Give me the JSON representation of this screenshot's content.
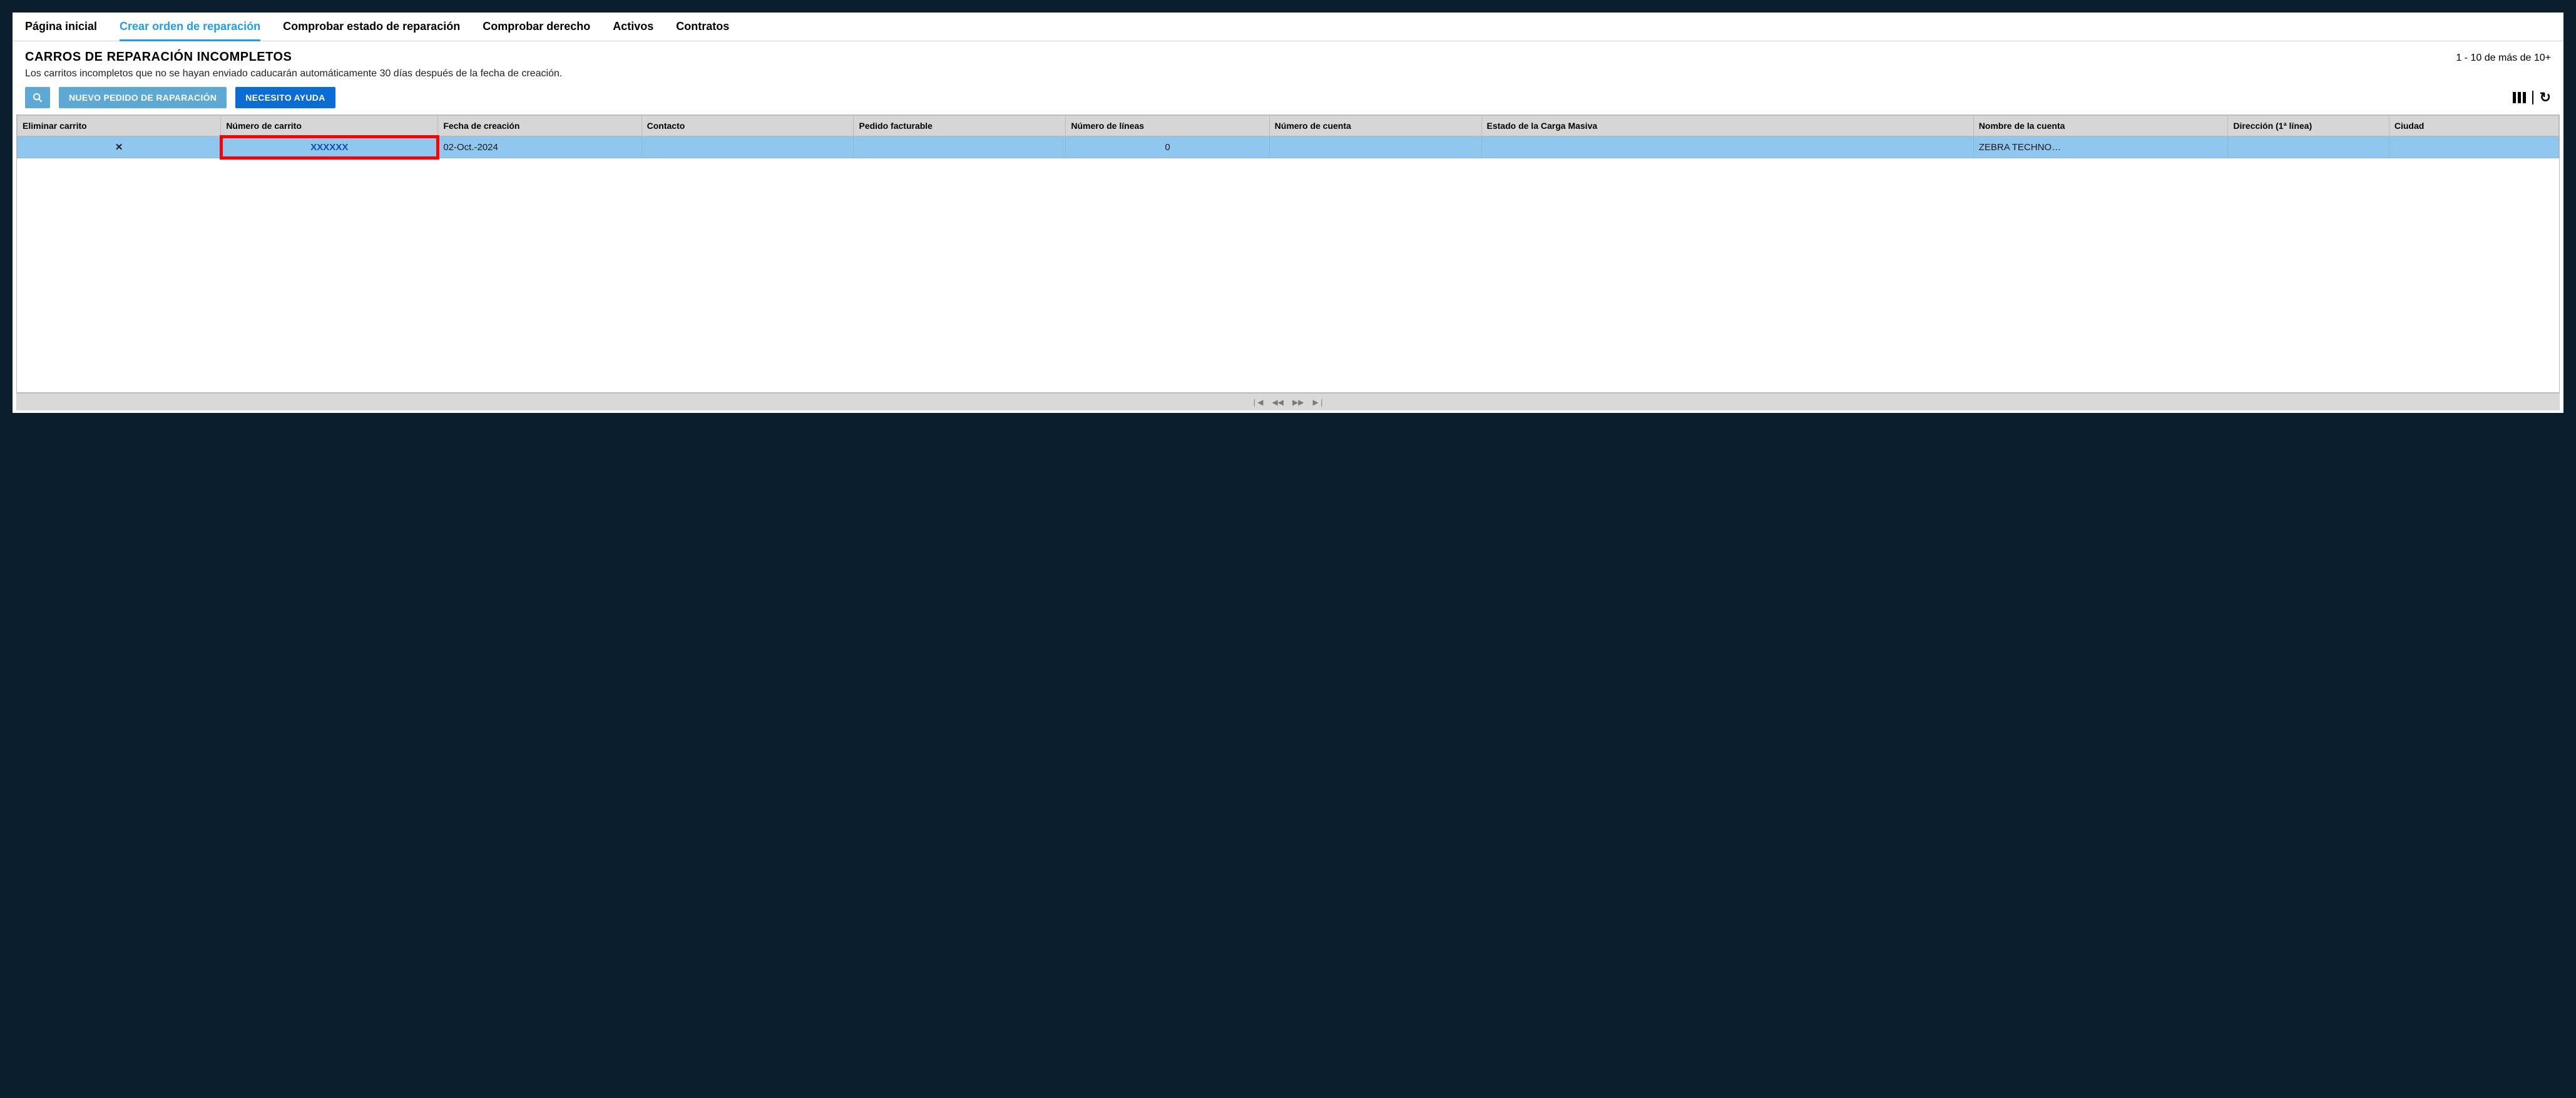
{
  "tabs": {
    "items": [
      {
        "label": "Página inicial"
      },
      {
        "label": "Crear orden de reparación"
      },
      {
        "label": "Comprobar estado de reparación"
      },
      {
        "label": "Comprobar derecho"
      },
      {
        "label": "Activos"
      },
      {
        "label": "Contratos"
      }
    ],
    "active_index": 1
  },
  "page": {
    "title": "CARROS DE REPARACIÓN INCOMPLETOS",
    "subtitle": "Los carritos incompletos que no se hayan enviado caducarán automáticamente 30 días después de la fecha de creación.",
    "count_label": "1 - 10 de más de 10+"
  },
  "toolbar": {
    "new_order_label": "NUEVO PEDIDO DE RAPARACIÓN",
    "help_label": "NECESITO AYUDA"
  },
  "table": {
    "headers": [
      "Eliminar carrito",
      "Número de carrito",
      "Fecha de creación",
      "Contacto",
      "Pedido facturable",
      "Número de líneas",
      "Número de cuenta",
      "Estado de la Carga Masiva",
      "Nombre de la cuenta",
      "Dirección (1ª línea)",
      "Ciudad"
    ],
    "rows": [
      {
        "delete_icon": "✕",
        "cart_number": "XXXXXX",
        "creation_date": "02-Oct.-2024",
        "contact": "",
        "billable_order": "",
        "line_count": "0",
        "account_number": "",
        "bulk_status": "",
        "account_name": "ZEBRA TECHNO…",
        "address1": "",
        "city": ""
      }
    ]
  },
  "pager": {
    "first": "❘◀",
    "prev": "◀◀",
    "next": "▶▶",
    "last": "▶❘"
  }
}
